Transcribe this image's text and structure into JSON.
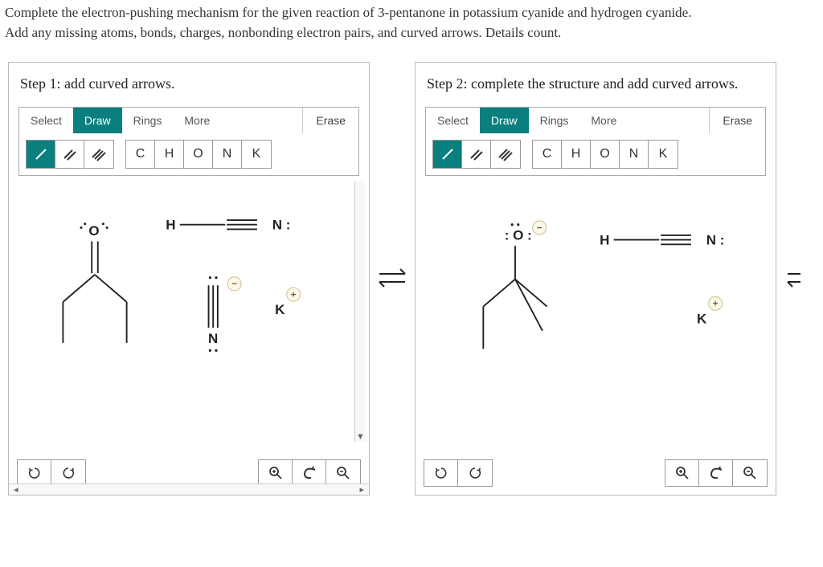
{
  "instructions": {
    "line1": "Complete the electron-pushing mechanism for the given reaction of 3-pentanone in potassium cyanide and hydrogen cyanide.",
    "line2": "Add any missing atoms, bonds, charges, nonbonding electron pairs, and curved arrows. Details count."
  },
  "toolbar": {
    "tabs": {
      "select": "Select",
      "draw": "Draw",
      "rings": "Rings",
      "more": "More"
    },
    "erase": "Erase",
    "bonds": {
      "single": "/",
      "double": "//",
      "triple": "///"
    },
    "elements": {
      "C": "C",
      "H": "H",
      "O": "O",
      "N": "N",
      "K": "K"
    }
  },
  "step1": {
    "title": "Step 1: add curved arrows.",
    "mol": {
      "O": "O",
      "H": "H",
      "N_top": "N :",
      "N_bot": "N",
      "K": "K",
      "minus": "−",
      "plus": "+"
    }
  },
  "step2": {
    "title": "Step 2: complete the structure and add curved arrows.",
    "mol": {
      "O": ": O :",
      "H": "H",
      "N": "N :",
      "K": "K",
      "minus": "−",
      "plus": "+"
    }
  },
  "controls": {
    "undo": "↺",
    "redo": "↻",
    "zoomin": "🔍+",
    "reset": "↩",
    "zoomout": "🔍−"
  }
}
